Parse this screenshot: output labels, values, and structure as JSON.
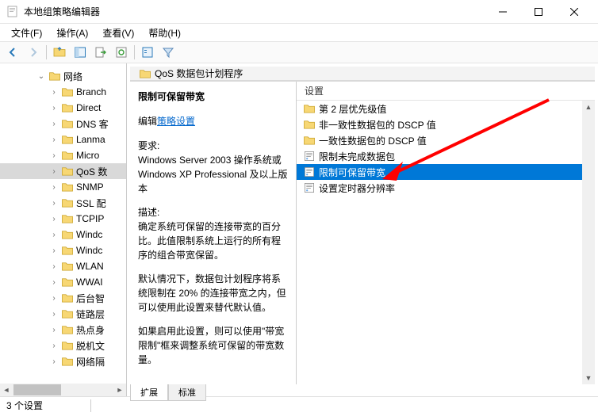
{
  "window": {
    "title": "本地组策略编辑器"
  },
  "menu": {
    "file": "文件(F)",
    "action": "操作(A)",
    "view": "查看(V)",
    "help": "帮助(H)"
  },
  "tree": {
    "root": "网络",
    "items": [
      "Branch",
      "Direct",
      "DNS 客",
      "Lanma",
      "Micro",
      "QoS 数",
      "SNMP",
      "SSL 配",
      "TCPIP",
      "Windc",
      "Windc",
      "WLAN",
      "WWAI",
      "后台智",
      "链路层",
      "热点身",
      "脱机文",
      "网络隔"
    ],
    "selected_index": 5
  },
  "header": {
    "title": "QoS 数据包计划程序"
  },
  "description": {
    "heading": "限制可保留带宽",
    "edit_prefix": "编辑",
    "edit_link": "策略设置",
    "req_label": "要求:",
    "req_text": "Windows Server 2003 操作系统或 Windows XP Professional 及以上版本",
    "desc_label": "描述:",
    "desc_p1": "确定系统可保留的连接带宽的百分比。此值限制系统上运行的所有程序的组合带宽保留。",
    "desc_p2": "默认情况下，数据包计划程序将系统限制在 20% 的连接带宽之内，但可以使用此设置来替代默认值。",
    "desc_p3": "如果启用此设置，则可以使用\"带宽限制\"框来调整系统可保留的带宽数量。"
  },
  "list": {
    "column": "设置",
    "items": [
      {
        "type": "folder",
        "label": "第 2 层优先级值"
      },
      {
        "type": "folder",
        "label": "非一致性数据包的 DSCP 值"
      },
      {
        "type": "folder",
        "label": "一致性数据包的 DSCP 值"
      },
      {
        "type": "setting",
        "label": "限制未完成数据包"
      },
      {
        "type": "setting",
        "label": "限制可保留带宽"
      },
      {
        "type": "setting",
        "label": "设置定时器分辨率"
      }
    ],
    "selected_index": 4
  },
  "tabs": {
    "extended": "扩展",
    "standard": "标准"
  },
  "status": {
    "text": "3 个设置"
  }
}
